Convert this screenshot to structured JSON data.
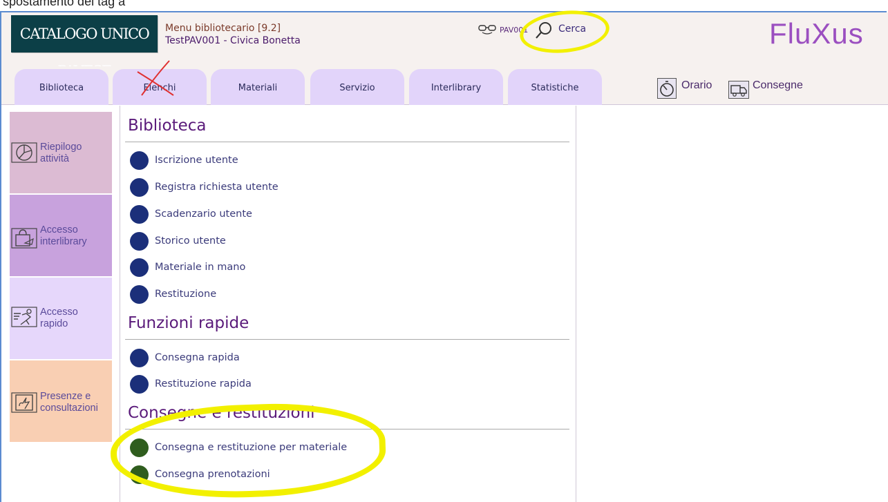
{
  "doc_strip": "spostamento dei tag a",
  "header": {
    "logo": "CATALOGO UNICO PAVESE",
    "menu_title": "Menu bibliotecario [9.2]",
    "menu_sub": "TestPAV001 - Civica Bonetta",
    "user": "PAV001",
    "search_label": "Cerca",
    "brand": "FluXus"
  },
  "tabs": [
    {
      "label": "Biblioteca"
    },
    {
      "label": "Elenchi"
    },
    {
      "label": "Materiali"
    },
    {
      "label": "Servizio"
    },
    {
      "label": "Interlibrary"
    },
    {
      "label": "Statistiche"
    }
  ],
  "toolbar": {
    "orario": "Orario",
    "consegne": "Consegne"
  },
  "sidebar": [
    {
      "line1": "Riepilogo",
      "line2": "attività",
      "bg": "#dcbbd3"
    },
    {
      "line1": "Accesso",
      "line2": "interlibrary",
      "bg": "#c8a2dd"
    },
    {
      "line1": "Accesso",
      "line2": "rapido",
      "bg": "#e6d7fb"
    },
    {
      "line1": "Presenze e",
      "line2": "consultazioni",
      "bg": "#f9cfb3"
    }
  ],
  "sections": [
    {
      "title": "Biblioteca",
      "items": [
        "Iscrizione utente",
        "Registra richiesta utente",
        "Scadenzario utente",
        "Storico utente",
        "Materiale in mano",
        "Restituzione"
      ]
    },
    {
      "title": "Funzioni rapide",
      "items": [
        "Consegna rapida",
        "Restituzione rapida"
      ]
    },
    {
      "title": "Consegne e restituzioni",
      "items": [
        "Consegna e restituzione per materiale",
        "Consegna prenotazioni"
      ]
    }
  ],
  "colors": {
    "item_dot": "#1b2f7a",
    "item_dot_alt": "#2f5d1e",
    "highlight": "#f2f000",
    "tab_bg": "#e2d4fa"
  }
}
